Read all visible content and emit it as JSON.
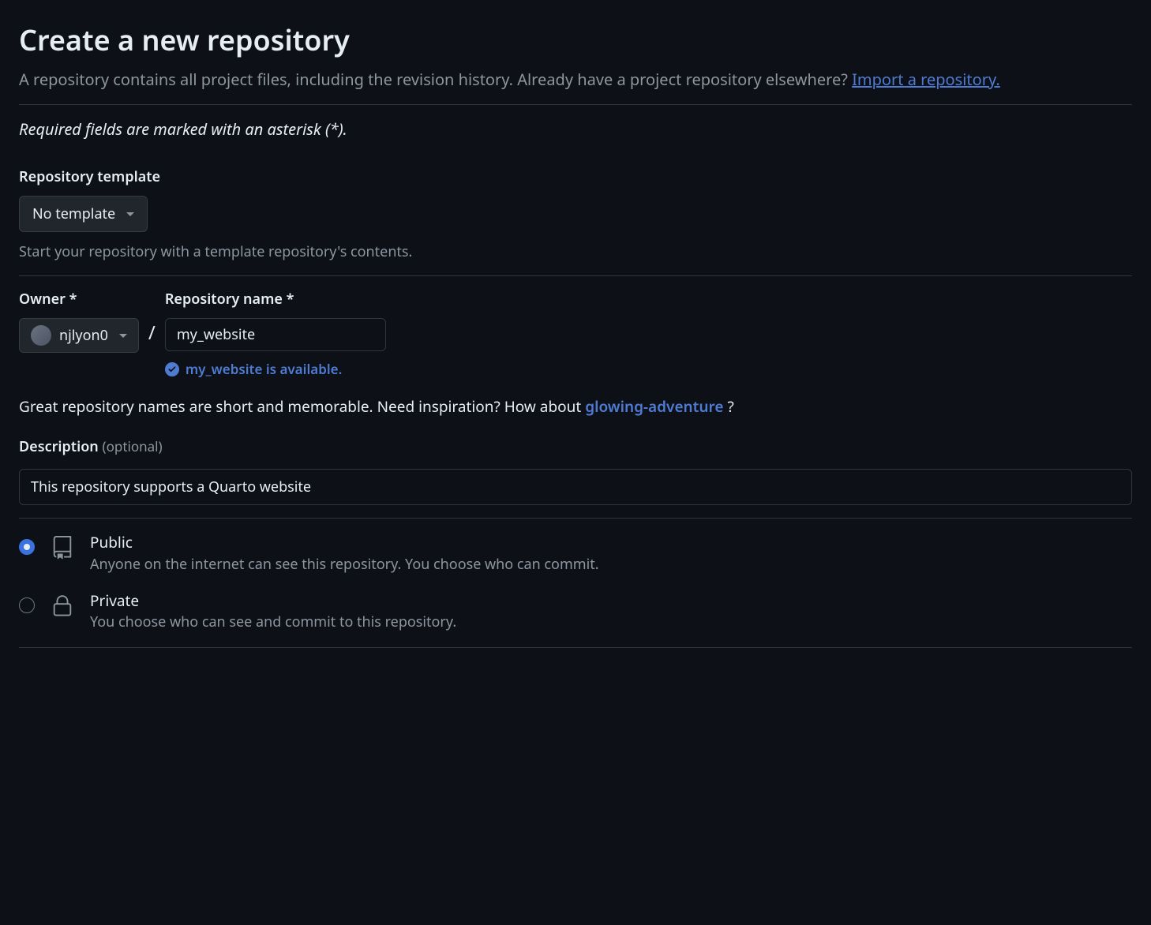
{
  "header": {
    "title": "Create a new repository",
    "subtitle_text": "A repository contains all project files, including the revision history. Already have a project repository elsewhere? ",
    "import_link": "Import a repository."
  },
  "required_note": "Required fields are marked with an asterisk (*).",
  "template": {
    "label": "Repository template",
    "selected": "No template",
    "helper": "Start your repository with a template repository's contents."
  },
  "owner": {
    "label": "Owner *",
    "value": "njlyon0"
  },
  "repo_name": {
    "label": "Repository name *",
    "value": "my_website",
    "available_text": "my_website is available."
  },
  "inspiration": {
    "prefix": "Great repository names are short and memorable. Need inspiration? How about ",
    "suggestion": "glowing-adventure",
    "suffix": " ?"
  },
  "description": {
    "label": "Description",
    "optional": "(optional)",
    "value": "This repository supports a Quarto website"
  },
  "visibility": {
    "public": {
      "title": "Public",
      "desc": "Anyone on the internet can see this repository. You choose who can commit.",
      "selected": true
    },
    "private": {
      "title": "Private",
      "desc": "You choose who can see and commit to this repository.",
      "selected": false
    }
  }
}
